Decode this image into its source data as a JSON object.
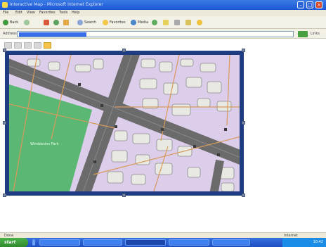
{
  "window": {
    "title": "Interactive Map - Microsoft Internet Explorer"
  },
  "menu": {
    "items": [
      "File",
      "Edit",
      "View",
      "Favorites",
      "Tools",
      "Help"
    ]
  },
  "toolbar": {
    "back_label": "Back",
    "search_label": "Search",
    "favorites_label": "Favorites",
    "media_label": "Media"
  },
  "address": {
    "label": "Address",
    "go_label": "Go",
    "links_label": "Links"
  },
  "map": {
    "park_label": "Wimbledon Park",
    "colors": {
      "frame": "#1d3c82",
      "land": "#dccdea",
      "road": "#6b6b6b",
      "park": "#5ab874",
      "building": "#e9e9e4",
      "boundary": "#d99a5b"
    }
  },
  "status": {
    "left": "Done",
    "right": "Internet"
  },
  "taskbar": {
    "start_label": "start",
    "clock": "10:42"
  }
}
